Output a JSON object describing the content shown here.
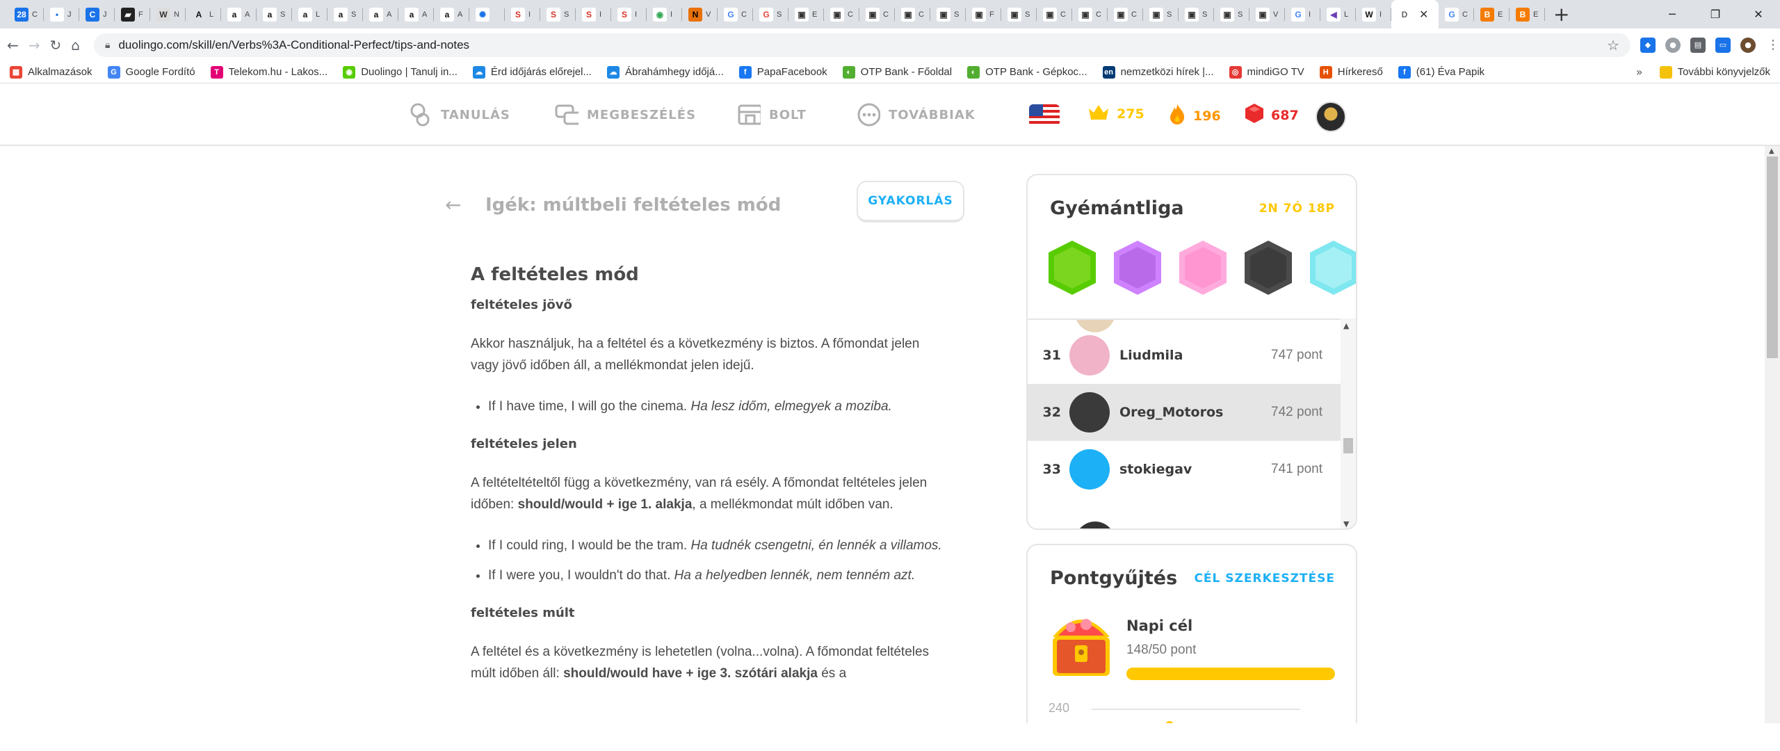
{
  "browser": {
    "tab_icons": [
      {
        "glyph": "28",
        "bg": "#1a73e8",
        "fg": "#fff",
        "suffix": "C"
      },
      {
        "glyph": "•",
        "bg": "#ffffff",
        "fg": "#1a73e8",
        "suffix": "J"
      },
      {
        "glyph": "C",
        "bg": "#1a73e8",
        "fg": "#fff",
        "suffix": "J"
      },
      {
        "glyph": "▰",
        "bg": "#222222",
        "fg": "#fff",
        "suffix": "F"
      },
      {
        "glyph": "W",
        "bg": "#dddddd",
        "fg": "#333",
        "suffix": "N"
      },
      {
        "glyph": "A",
        "bg": "#dee1e6",
        "fg": "#111",
        "suffix": "L"
      },
      {
        "glyph": "a",
        "bg": "#ffffff",
        "fg": "#111",
        "suffix": "A"
      },
      {
        "glyph": "a",
        "bg": "#ffffff",
        "fg": "#111",
        "suffix": "S"
      },
      {
        "glyph": "a",
        "bg": "#ffffff",
        "fg": "#111",
        "suffix": "L"
      },
      {
        "glyph": "a",
        "bg": "#ffffff",
        "fg": "#111",
        "suffix": "S"
      },
      {
        "glyph": "a",
        "bg": "#ffffff",
        "fg": "#111",
        "suffix": "A"
      },
      {
        "glyph": "a",
        "bg": "#ffffff",
        "fg": "#111",
        "suffix": "A"
      },
      {
        "glyph": "a",
        "bg": "#ffffff",
        "fg": "#111",
        "suffix": "A"
      },
      {
        "glyph": "✺",
        "bg": "#ffffff",
        "fg": "#1a73e8",
        "suffix": ""
      },
      {
        "glyph": "S",
        "bg": "#ffffff",
        "fg": "#d93025",
        "suffix": "I"
      },
      {
        "glyph": "S",
        "bg": "#ffffff",
        "fg": "#d93025",
        "suffix": "S"
      },
      {
        "glyph": "S",
        "bg": "#ffffff",
        "fg": "#d93025",
        "suffix": "I"
      },
      {
        "glyph": "S",
        "bg": "#ffffff",
        "fg": "#d93025",
        "suffix": "I"
      },
      {
        "glyph": "◉",
        "bg": "#ffffff",
        "fg": "#34a853",
        "suffix": "I"
      },
      {
        "glyph": "N",
        "bg": "#e8710a",
        "fg": "#000",
        "suffix": "V"
      },
      {
        "glyph": "G",
        "bg": "#ffffff",
        "fg": "#4285f4",
        "suffix": "C"
      },
      {
        "glyph": "G",
        "bg": "#ffffff",
        "fg": "#ea4335",
        "suffix": "S"
      },
      {
        "glyph": "▣",
        "bg": "#ffffff",
        "fg": "#333",
        "suffix": "E"
      },
      {
        "glyph": "▣",
        "bg": "#ffffff",
        "fg": "#333",
        "suffix": "C"
      },
      {
        "glyph": "▣",
        "bg": "#ffffff",
        "fg": "#333",
        "suffix": "C"
      },
      {
        "glyph": "▣",
        "bg": "#ffffff",
        "fg": "#333",
        "suffix": "C"
      },
      {
        "glyph": "▣",
        "bg": "#ffffff",
        "fg": "#333",
        "suffix": "S"
      },
      {
        "glyph": "▣",
        "bg": "#ffffff",
        "fg": "#333",
        "suffix": "F"
      },
      {
        "glyph": "▣",
        "bg": "#ffffff",
        "fg": "#333",
        "suffix": "S"
      },
      {
        "glyph": "▣",
        "bg": "#ffffff",
        "fg": "#333",
        "suffix": "C"
      },
      {
        "glyph": "▣",
        "bg": "#ffffff",
        "fg": "#333",
        "suffix": "C"
      },
      {
        "glyph": "▣",
        "bg": "#ffffff",
        "fg": "#333",
        "suffix": "C"
      },
      {
        "glyph": "▣",
        "bg": "#ffffff",
        "fg": "#333",
        "suffix": "S"
      },
      {
        "glyph": "▣",
        "bg": "#ffffff",
        "fg": "#333",
        "suffix": "S"
      },
      {
        "glyph": "▣",
        "bg": "#ffffff",
        "fg": "#333",
        "suffix": "S"
      },
      {
        "glyph": "▣",
        "bg": "#ffffff",
        "fg": "#333",
        "suffix": "V"
      },
      {
        "glyph": "G",
        "bg": "#ffffff",
        "fg": "#4285f4",
        "suffix": "I"
      },
      {
        "glyph": "◀",
        "bg": "#ffffff",
        "fg": "#6a3fb5",
        "suffix": "L"
      },
      {
        "glyph": "W",
        "bg": "#ffffff",
        "fg": "#111",
        "suffix": "I"
      }
    ],
    "active_tab": {
      "glyph": "D"
    },
    "after_tabs": [
      {
        "glyph": "G",
        "bg": "#ffffff",
        "fg": "#4285f4",
        "suffix": "C"
      },
      {
        "glyph": "B",
        "bg": "#f57c00",
        "fg": "#fff",
        "suffix": "E"
      },
      {
        "glyph": "B",
        "bg": "#f57c00",
        "fg": "#fff",
        "suffix": "E"
      }
    ],
    "url": "duolingo.com/skill/en/Verbs%3A-Conditional-Perfect/tips-and-notes",
    "bookmarks": [
      {
        "label": "Alkalmazások",
        "icon": "▦",
        "bg": "#ea4335"
      },
      {
        "label": "Google Fordító",
        "icon": "G",
        "bg": "#4285f4"
      },
      {
        "label": "Telekom.hu - Lakos...",
        "icon": "T",
        "bg": "#e20074"
      },
      {
        "label": "Duolingo | Tanulj in...",
        "icon": "◉",
        "bg": "#58cc02"
      },
      {
        "label": "Érd időjárás előrejel...",
        "icon": "☁",
        "bg": "#1e88e5"
      },
      {
        "label": "Ábrahámhegy időjá...",
        "icon": "☁",
        "bg": "#1e88e5"
      },
      {
        "label": "PapaFacebook",
        "icon": "f",
        "bg": "#1877f2"
      },
      {
        "label": "OTP Bank - Főoldal",
        "icon": "◐",
        "bg": "#52ae30"
      },
      {
        "label": "OTP Bank - Gépkoc...",
        "icon": "◐",
        "bg": "#52ae30"
      },
      {
        "label": "nemzetközi hírek |...",
        "icon": "en",
        "bg": "#003b73"
      },
      {
        "label": "mindiGO TV",
        "icon": "◎",
        "bg": "#e53935"
      },
      {
        "label": "Hírkereső",
        "icon": "H",
        "bg": "#e65100"
      },
      {
        "label": "(61) Éva Papik",
        "icon": "f",
        "bg": "#1877f2"
      }
    ],
    "bookmarks_more": "»",
    "other_bookmarks": "További könyvjelzők"
  },
  "duo_nav": {
    "items": [
      {
        "label": "TANULÁS",
        "icon": "learn-icon"
      },
      {
        "label": "MEGBESZÉLÉS",
        "icon": "discuss-icon"
      },
      {
        "label": "BOLT",
        "icon": "shop-icon"
      },
      {
        "label": "TOVÁBBIAK",
        "icon": "more-icon"
      }
    ],
    "crowns": "275",
    "streak": "196",
    "gems": "687",
    "colors": {
      "crown": "#ffc800",
      "streak": "#ff9600",
      "gems": "#ea2b2b"
    }
  },
  "page": {
    "back": "←",
    "title": "Igék: múltbeli feltételes mód",
    "practice_label": "GYAKORLÁS"
  },
  "article": {
    "heading": "A feltételes mód",
    "sections": [
      {
        "subheading": "feltételes jövő",
        "paragraph_html": "Akkor használjuk, ha a feltétel és a következmény is biztos. A főmondat jelen vagy jövő időben áll, a mellékmondat jelen idejű.",
        "examples": [
          {
            "en": "If I have time, I will go the cinema.",
            "hu": "Ha lesz időm, elmegyek a moziba."
          }
        ]
      },
      {
        "subheading": "feltételes jelen",
        "paragraph_html": "A feltételtételtől függ a következmény, van rá esély. A főmondat feltételes jelen időben: <b>should/would + ige 1. alakja</b>, a mellékmondat múlt időben van.",
        "examples": [
          {
            "en": "If I could ring, I would be the tram.",
            "hu": "Ha tudnék csengetni, én lennék a villamos."
          },
          {
            "en": "If I were you, I wouldn't do that.",
            "hu": "Ha a helyedben lennék, nem tenném azt."
          }
        ]
      },
      {
        "subheading": "feltételes múlt",
        "paragraph_html": "A feltétel és a következmény is lehetetlen (volna...volna). A főmondat feltételes múlt időben áll: <b>should/would have + ige 3. szótári alakja</b> és a",
        "examples": []
      }
    ]
  },
  "league": {
    "title": "Gyémántliga",
    "countdown": "2N 7Ó 18P",
    "badges": [
      {
        "outer": "#58cc02",
        "inner": "#7bd61f"
      },
      {
        "outer": "#ce82ff",
        "inner": "#b96ae8"
      },
      {
        "outer": "#ffaadd",
        "inner": "#ff96d1"
      },
      {
        "outer": "#4b4b4b",
        "inner": "#3c3c3c"
      },
      {
        "outer": "#7ee7f0",
        "inner": "#a5f0f5"
      }
    ],
    "rows": [
      {
        "rank": "31",
        "name": "Liudmila",
        "points": "747 pont",
        "avatar": "#f0b3c8",
        "me": false
      },
      {
        "rank": "32",
        "name": "Oreg_Motoros",
        "points": "742 pont",
        "avatar": "#3a3a3a",
        "me": true
      },
      {
        "rank": "33",
        "name": "stokiegav",
        "points": "741 pont",
        "avatar": "#1cb0f6",
        "me": false
      }
    ]
  },
  "goal": {
    "title": "Pontgyűjtés",
    "edit": "CÉL SZERKESZTÉSE",
    "name": "Napi cél",
    "progress_text": "148/50 pont",
    "progress": 1.0,
    "chart_label": "240",
    "chart_points": [
      240,
      230
    ]
  }
}
